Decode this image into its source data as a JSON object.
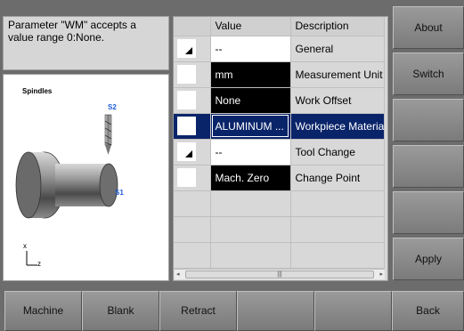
{
  "info": {
    "message": "Parameter \"WM\" accepts a value range 0:None."
  },
  "drawing": {
    "title": "Spindles",
    "s1": "S1",
    "s2": "S2",
    "axis_x": "x",
    "axis_z": "z"
  },
  "table": {
    "headers": [
      "",
      "Value",
      "Description"
    ],
    "rows": [
      {
        "marker": "triangle",
        "value": "--",
        "value_style": "white",
        "description": "General"
      },
      {
        "marker": "empty",
        "value": "mm",
        "value_style": "black",
        "description": "Measurement Unit"
      },
      {
        "marker": "empty",
        "value": "None",
        "value_style": "black",
        "description": "Work Offset"
      },
      {
        "marker": "empty",
        "value": "ALUMINUM ...",
        "value_style": "selected",
        "description": "Workpiece Material"
      },
      {
        "marker": "triangle",
        "value": "--",
        "value_style": "white",
        "description": "Tool Change"
      },
      {
        "marker": "empty",
        "value": "Mach. Zero",
        "value_style": "black",
        "description": "Change Point"
      }
    ],
    "scroll_thumb": "|||"
  },
  "right_buttons": [
    "About",
    "Switch",
    "",
    "",
    "",
    "Apply"
  ],
  "bottom_buttons": [
    "Machine",
    "Blank",
    "Retract",
    "",
    "",
    "Back"
  ],
  "colors": {
    "selection": "#0a246a",
    "accent_blue": "#1f5bd6"
  }
}
